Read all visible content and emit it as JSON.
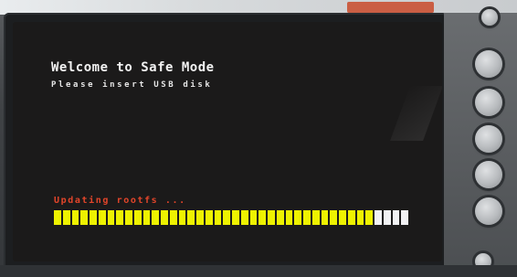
{
  "screen": {
    "title": "Welcome to Safe Mode",
    "message": "Please insert USB disk",
    "status": "Updating rootfs ..."
  },
  "progress": {
    "segments_total": 40,
    "segments_filled": 36,
    "fill_color": "#EEF200",
    "empty_color": "#F2F2F4"
  },
  "hardware": {
    "softkeys": [
      "softkey-1",
      "softkey-2",
      "softkey-3",
      "softkey-4",
      "softkey-5"
    ]
  },
  "colors": {
    "status_text": "#E2452A",
    "screen_background": "#1B1A1A"
  }
}
